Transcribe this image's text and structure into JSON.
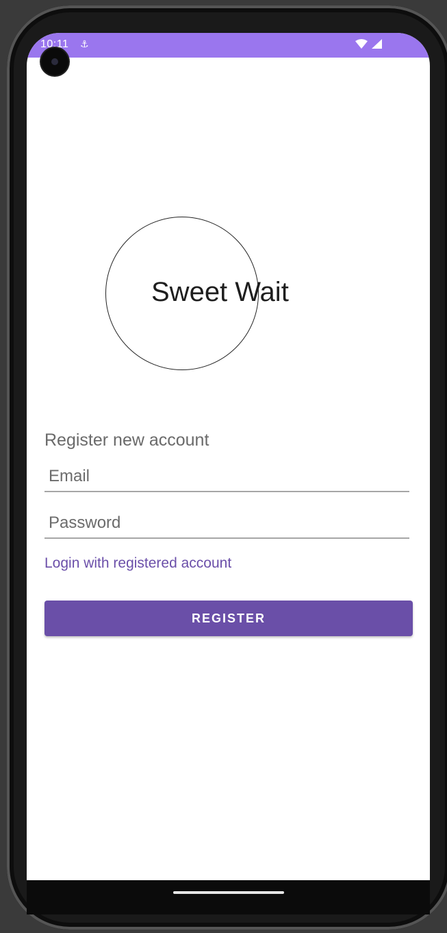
{
  "status_bar": {
    "time": "10:11",
    "background_color": "#9a76ee",
    "icons": [
      "usb-icon",
      "wifi-icon",
      "signal-icon"
    ]
  },
  "logo": {
    "text": "Sweet Wait"
  },
  "form": {
    "title": "Register new account",
    "email_placeholder": "Email",
    "email_value": "",
    "password_placeholder": "Password",
    "password_value": ""
  },
  "login_link": {
    "label": "Login with registered account",
    "color": "#6b4fa9"
  },
  "register_button": {
    "label": "REGISTER",
    "color": "#6a4fa8"
  }
}
